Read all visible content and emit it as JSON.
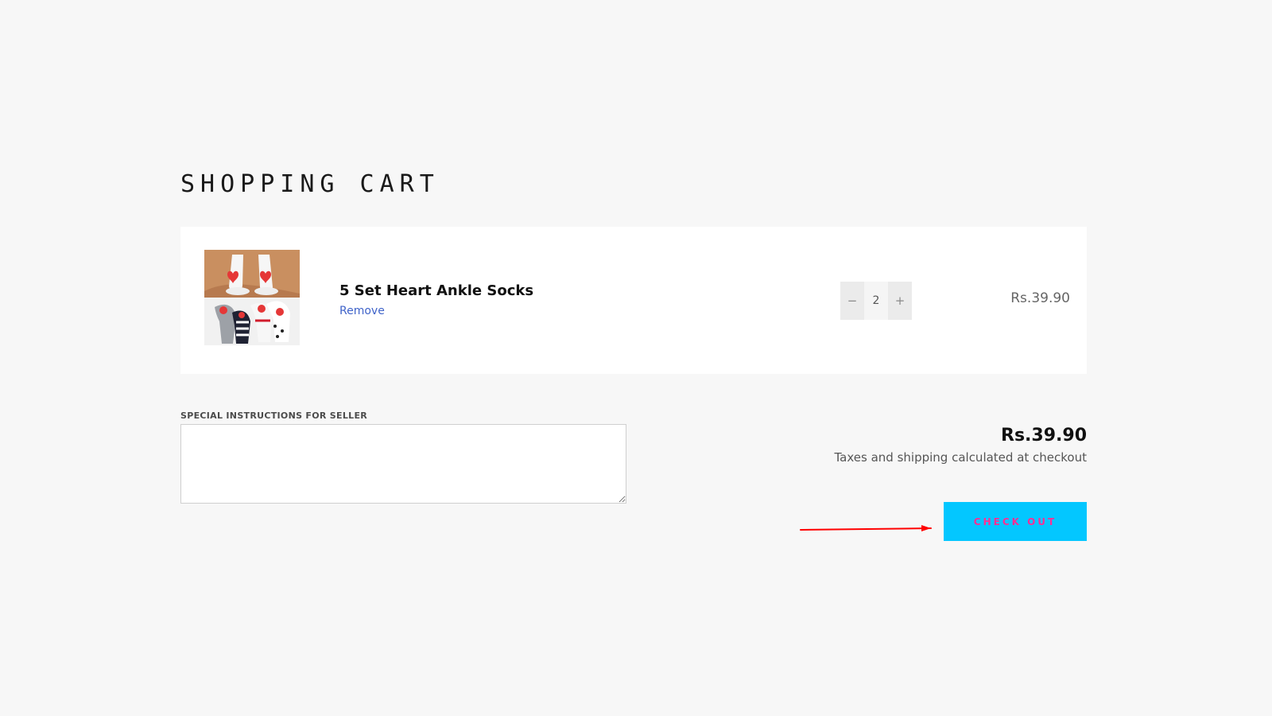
{
  "page": {
    "title": "SHOPPING CART"
  },
  "cart": {
    "item": {
      "image": {
        "icon": "product-photo-icon"
      },
      "title": "5 Set Heart Ankle Socks",
      "remove_label": "Remove",
      "quantity": {
        "decrease_label": "−",
        "value": "2",
        "increase_label": "+"
      },
      "price": "Rs.39.90"
    }
  },
  "notes": {
    "label": "SPECIAL INSTRUCTIONS FOR SELLER",
    "value": "",
    "placeholder": ""
  },
  "summary": {
    "subtotal": "Rs.39.90",
    "tax_note": "Taxes and shipping calculated at checkout",
    "checkout_label": "CHECK OUT"
  },
  "colors": {
    "background": "#f7f7f7",
    "card": "#ffffff",
    "link": "#3f63c9",
    "checkout_background": "#03c7ff",
    "checkout_text": "#ff2f95",
    "annotation_arrow": "#ff0000"
  }
}
